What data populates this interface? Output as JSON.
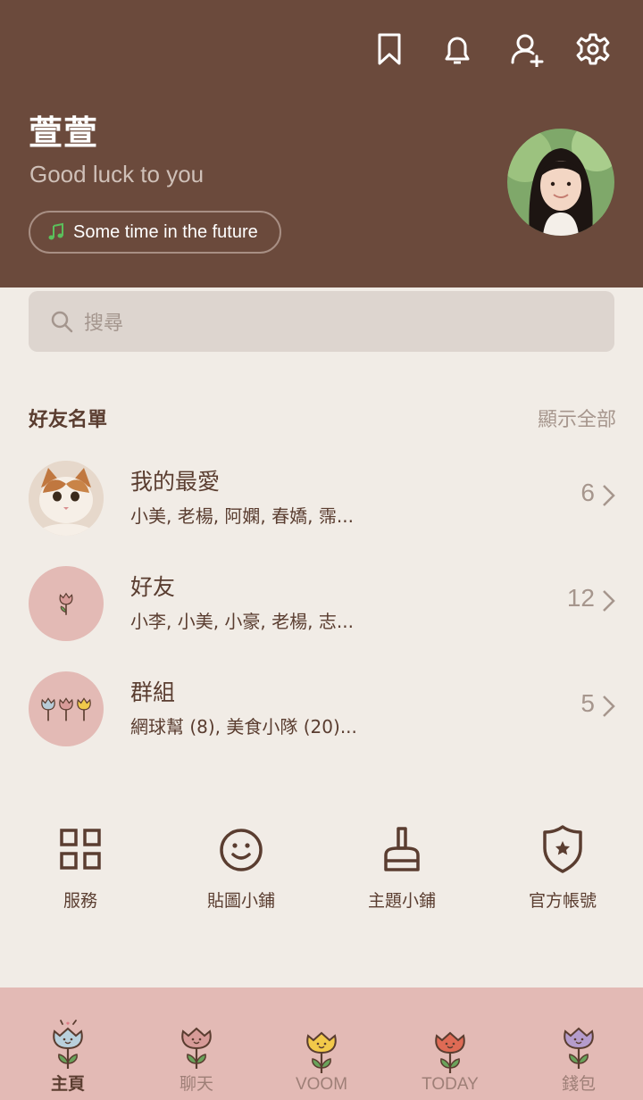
{
  "colors": {
    "header_bg": "#6b4a3c",
    "body_bg": "#f1ece6",
    "nav_bg": "#e3bab5",
    "text_dark": "#5a3d30",
    "text_muted": "#a6968d"
  },
  "header": {
    "icons": [
      "bookmark-icon",
      "bell-icon",
      "add-friend-icon",
      "settings-icon"
    ],
    "name": "萱萱",
    "status": "Good luck to you",
    "music": "Some time in the future"
  },
  "search": {
    "placeholder": "搜尋"
  },
  "friends": {
    "title": "好友名單",
    "show_all": "顯示全部",
    "rows": [
      {
        "title": "我的最愛",
        "subtitle": "小美, 老楊, 阿嫻, 春嬌, 霈...",
        "count": "6"
      },
      {
        "title": "好友",
        "subtitle": "小李, 小美, 小豪, 老楊, 志...",
        "count": "12"
      },
      {
        "title": "群組",
        "subtitle": "網球幫 (8), 美食小隊 (20)...",
        "count": "5"
      }
    ]
  },
  "quick_menu": [
    {
      "label": "服務",
      "icon": "grid-icon"
    },
    {
      "label": "貼圖小鋪",
      "icon": "smiley-icon"
    },
    {
      "label": "主題小鋪",
      "icon": "brush-icon"
    },
    {
      "label": "官方帳號",
      "icon": "shield-star-icon"
    }
  ],
  "bottom_nav": [
    {
      "label": "主頁",
      "icon": "tulip-blue-icon",
      "active": true
    },
    {
      "label": "聊天",
      "icon": "tulip-pink-icon",
      "active": false
    },
    {
      "label": "VOOM",
      "icon": "tulip-yellow-icon",
      "active": false
    },
    {
      "label": "TODAY",
      "icon": "tulip-red-icon",
      "active": false
    },
    {
      "label": "錢包",
      "icon": "tulip-purple-icon",
      "active": false
    }
  ]
}
